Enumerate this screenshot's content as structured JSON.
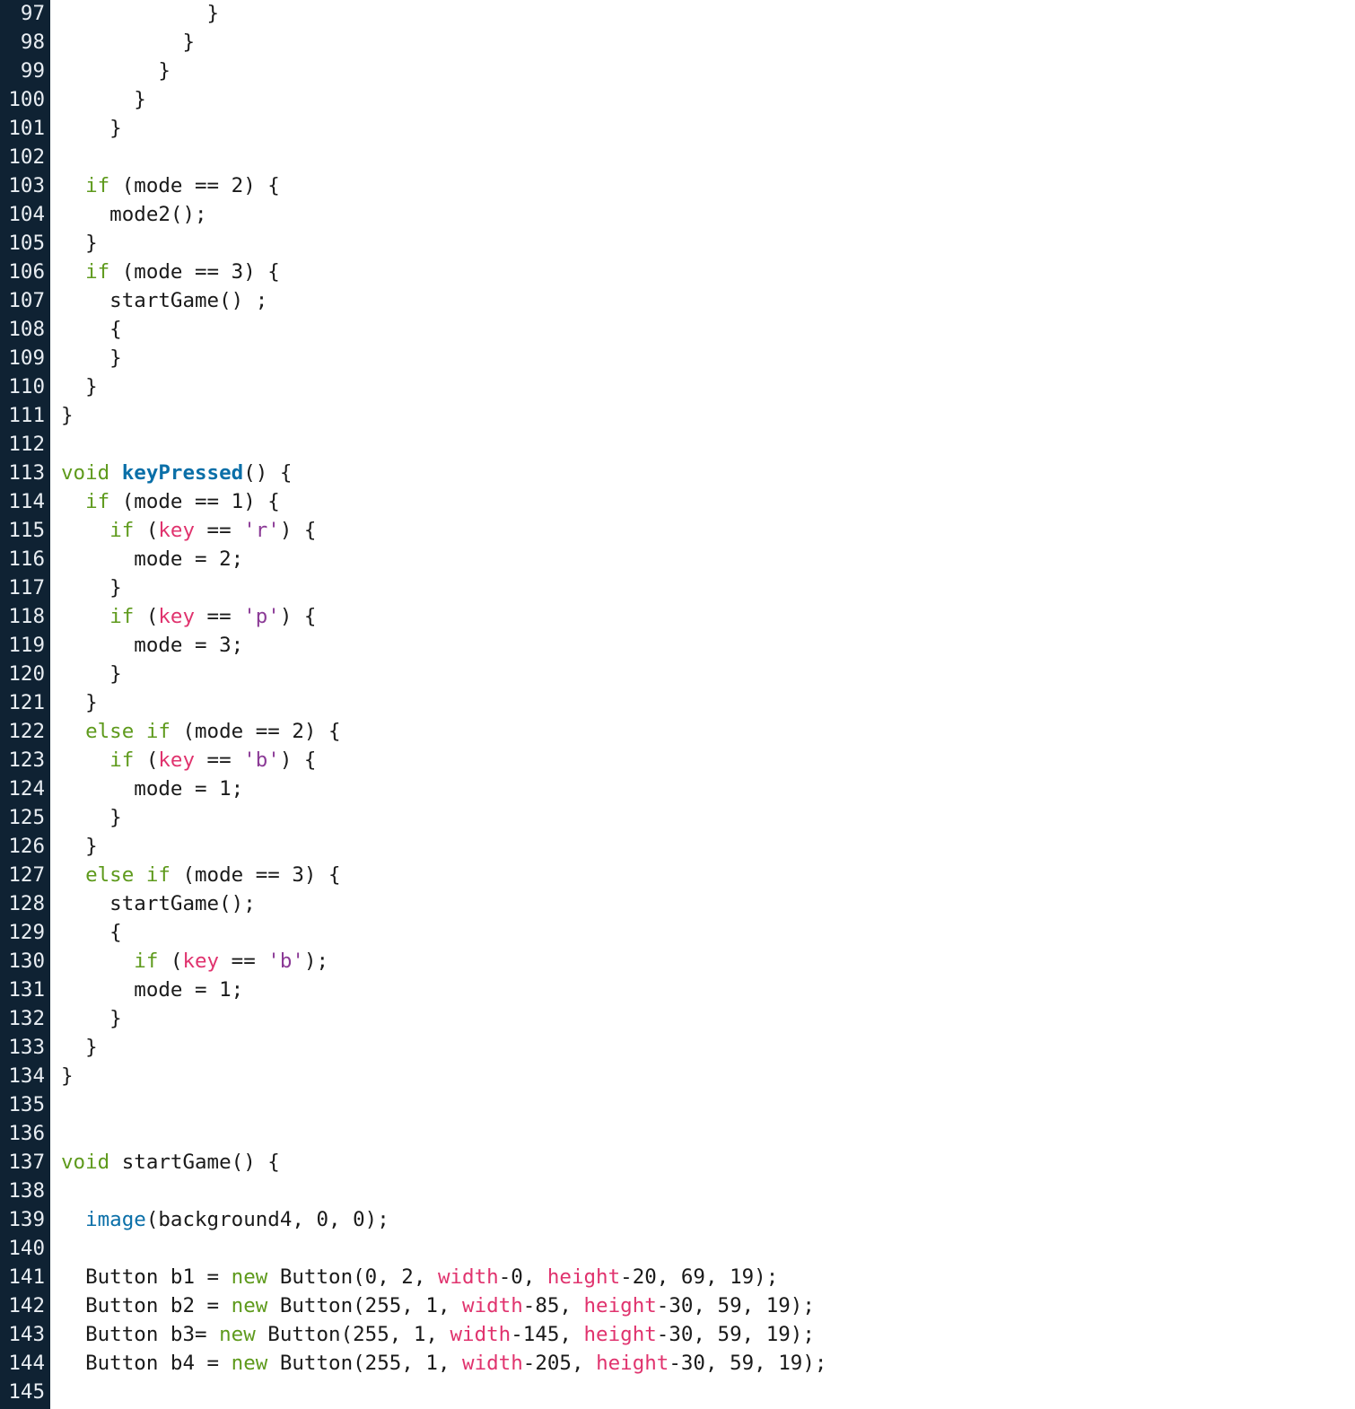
{
  "editor": {
    "colors": {
      "gutter_bg": "#0f2233",
      "gutter_text": "#e8edf2",
      "code_bg": "#ffffff",
      "keyword": "#5e9a1c",
      "function_name": "#0a6fa8",
      "builtin": "#0a6fa8",
      "variable": "#e0336e",
      "string": "#8b3a96",
      "text": "#1a1a1a"
    },
    "lines": [
      {
        "n": "97",
        "tokens": [
          {
            "t": "tx",
            "v": "            }"
          }
        ]
      },
      {
        "n": "98",
        "tokens": [
          {
            "t": "tx",
            "v": "          }"
          }
        ]
      },
      {
        "n": "99",
        "tokens": [
          {
            "t": "tx",
            "v": "        }"
          }
        ]
      },
      {
        "n": "100",
        "tokens": [
          {
            "t": "tx",
            "v": "      }"
          }
        ]
      },
      {
        "n": "101",
        "tokens": [
          {
            "t": "tx",
            "v": "    }"
          }
        ]
      },
      {
        "n": "102",
        "tokens": []
      },
      {
        "n": "103",
        "tokens": [
          {
            "t": "tx",
            "v": "  "
          },
          {
            "t": "kw",
            "v": "if"
          },
          {
            "t": "tx",
            "v": " (mode == 2) {"
          }
        ]
      },
      {
        "n": "104",
        "tokens": [
          {
            "t": "tx",
            "v": "    mode2();"
          }
        ]
      },
      {
        "n": "105",
        "tokens": [
          {
            "t": "tx",
            "v": "  }"
          }
        ]
      },
      {
        "n": "106",
        "tokens": [
          {
            "t": "tx",
            "v": "  "
          },
          {
            "t": "kw",
            "v": "if"
          },
          {
            "t": "tx",
            "v": " (mode == 3) {"
          }
        ]
      },
      {
        "n": "107",
        "tokens": [
          {
            "t": "tx",
            "v": "    startGame() ;"
          }
        ]
      },
      {
        "n": "108",
        "tokens": [
          {
            "t": "tx",
            "v": "    {"
          }
        ]
      },
      {
        "n": "109",
        "tokens": [
          {
            "t": "tx",
            "v": "    }"
          }
        ]
      },
      {
        "n": "110",
        "tokens": [
          {
            "t": "tx",
            "v": "  }"
          }
        ]
      },
      {
        "n": "111",
        "tokens": [
          {
            "t": "tx",
            "v": "}"
          }
        ]
      },
      {
        "n": "112",
        "tokens": []
      },
      {
        "n": "113",
        "tokens": [
          {
            "t": "kw",
            "v": "void"
          },
          {
            "t": "tx",
            "v": " "
          },
          {
            "t": "fn",
            "v": "keyPressed"
          },
          {
            "t": "tx",
            "v": "() {"
          }
        ]
      },
      {
        "n": "114",
        "tokens": [
          {
            "t": "tx",
            "v": "  "
          },
          {
            "t": "kw",
            "v": "if"
          },
          {
            "t": "tx",
            "v": " (mode == 1) {"
          }
        ]
      },
      {
        "n": "115",
        "tokens": [
          {
            "t": "tx",
            "v": "    "
          },
          {
            "t": "kw",
            "v": "if"
          },
          {
            "t": "tx",
            "v": " ("
          },
          {
            "t": "va",
            "v": "key"
          },
          {
            "t": "tx",
            "v": " == "
          },
          {
            "t": "st",
            "v": "'r'"
          },
          {
            "t": "tx",
            "v": ") {"
          }
        ]
      },
      {
        "n": "116",
        "tokens": [
          {
            "t": "tx",
            "v": "      mode = 2;"
          }
        ]
      },
      {
        "n": "117",
        "tokens": [
          {
            "t": "tx",
            "v": "    }"
          }
        ]
      },
      {
        "n": "118",
        "tokens": [
          {
            "t": "tx",
            "v": "    "
          },
          {
            "t": "kw",
            "v": "if"
          },
          {
            "t": "tx",
            "v": " ("
          },
          {
            "t": "va",
            "v": "key"
          },
          {
            "t": "tx",
            "v": " == "
          },
          {
            "t": "st",
            "v": "'p'"
          },
          {
            "t": "tx",
            "v": ") {"
          }
        ]
      },
      {
        "n": "119",
        "tokens": [
          {
            "t": "tx",
            "v": "      mode = 3;"
          }
        ]
      },
      {
        "n": "120",
        "tokens": [
          {
            "t": "tx",
            "v": "    }"
          }
        ]
      },
      {
        "n": "121",
        "tokens": [
          {
            "t": "tx",
            "v": "  }"
          }
        ]
      },
      {
        "n": "122",
        "tokens": [
          {
            "t": "tx",
            "v": "  "
          },
          {
            "t": "kw",
            "v": "else if"
          },
          {
            "t": "tx",
            "v": " (mode == 2) {"
          }
        ]
      },
      {
        "n": "123",
        "tokens": [
          {
            "t": "tx",
            "v": "    "
          },
          {
            "t": "kw",
            "v": "if"
          },
          {
            "t": "tx",
            "v": " ("
          },
          {
            "t": "va",
            "v": "key"
          },
          {
            "t": "tx",
            "v": " == "
          },
          {
            "t": "st",
            "v": "'b'"
          },
          {
            "t": "tx",
            "v": ") {"
          }
        ]
      },
      {
        "n": "124",
        "tokens": [
          {
            "t": "tx",
            "v": "      mode = 1;"
          }
        ]
      },
      {
        "n": "125",
        "tokens": [
          {
            "t": "tx",
            "v": "    }"
          }
        ]
      },
      {
        "n": "126",
        "tokens": [
          {
            "t": "tx",
            "v": "  }"
          }
        ]
      },
      {
        "n": "127",
        "tokens": [
          {
            "t": "tx",
            "v": "  "
          },
          {
            "t": "kw",
            "v": "else if"
          },
          {
            "t": "tx",
            "v": " (mode == 3) {"
          }
        ]
      },
      {
        "n": "128",
        "tokens": [
          {
            "t": "tx",
            "v": "    startGame();"
          }
        ]
      },
      {
        "n": "129",
        "tokens": [
          {
            "t": "tx",
            "v": "    {"
          }
        ]
      },
      {
        "n": "130",
        "tokens": [
          {
            "t": "tx",
            "v": "      "
          },
          {
            "t": "kw",
            "v": "if"
          },
          {
            "t": "tx",
            "v": " ("
          },
          {
            "t": "va",
            "v": "key"
          },
          {
            "t": "tx",
            "v": " == "
          },
          {
            "t": "st",
            "v": "'b'"
          },
          {
            "t": "tx",
            "v": ");"
          }
        ]
      },
      {
        "n": "131",
        "tokens": [
          {
            "t": "tx",
            "v": "      mode = 1;"
          }
        ]
      },
      {
        "n": "132",
        "tokens": [
          {
            "t": "tx",
            "v": "    }"
          }
        ]
      },
      {
        "n": "133",
        "tokens": [
          {
            "t": "tx",
            "v": "  }"
          }
        ]
      },
      {
        "n": "134",
        "tokens": [
          {
            "t": "tx",
            "v": "}"
          }
        ]
      },
      {
        "n": "135",
        "tokens": []
      },
      {
        "n": "136",
        "tokens": []
      },
      {
        "n": "137",
        "tokens": [
          {
            "t": "kw",
            "v": "void"
          },
          {
            "t": "tx",
            "v": " startGame() {"
          }
        ]
      },
      {
        "n": "138",
        "tokens": []
      },
      {
        "n": "139",
        "tokens": [
          {
            "t": "tx",
            "v": "  "
          },
          {
            "t": "bi",
            "v": "image"
          },
          {
            "t": "tx",
            "v": "(background4, 0, 0);"
          }
        ]
      },
      {
        "n": "140",
        "tokens": []
      },
      {
        "n": "141",
        "tokens": [
          {
            "t": "tx",
            "v": "  Button b1 = "
          },
          {
            "t": "kw",
            "v": "new"
          },
          {
            "t": "tx",
            "v": " Button(0, 2, "
          },
          {
            "t": "va",
            "v": "width"
          },
          {
            "t": "tx",
            "v": "-0, "
          },
          {
            "t": "va",
            "v": "height"
          },
          {
            "t": "tx",
            "v": "-20, 69, 19);"
          }
        ]
      },
      {
        "n": "142",
        "tokens": [
          {
            "t": "tx",
            "v": "  Button b2 = "
          },
          {
            "t": "kw",
            "v": "new"
          },
          {
            "t": "tx",
            "v": " Button(255, 1, "
          },
          {
            "t": "va",
            "v": "width"
          },
          {
            "t": "tx",
            "v": "-85, "
          },
          {
            "t": "va",
            "v": "height"
          },
          {
            "t": "tx",
            "v": "-30, 59, 19);"
          }
        ]
      },
      {
        "n": "143",
        "tokens": [
          {
            "t": "tx",
            "v": "  Button b3= "
          },
          {
            "t": "kw",
            "v": "new"
          },
          {
            "t": "tx",
            "v": " Button(255, 1, "
          },
          {
            "t": "va",
            "v": "width"
          },
          {
            "t": "tx",
            "v": "-145, "
          },
          {
            "t": "va",
            "v": "height"
          },
          {
            "t": "tx",
            "v": "-30, 59, 19);"
          }
        ]
      },
      {
        "n": "144",
        "tokens": [
          {
            "t": "tx",
            "v": "  Button b4 = "
          },
          {
            "t": "kw",
            "v": "new"
          },
          {
            "t": "tx",
            "v": " Button(255, 1, "
          },
          {
            "t": "va",
            "v": "width"
          },
          {
            "t": "tx",
            "v": "-205, "
          },
          {
            "t": "va",
            "v": "height"
          },
          {
            "t": "tx",
            "v": "-30, 59, 19);"
          }
        ]
      },
      {
        "n": "145",
        "tokens": []
      }
    ]
  }
}
